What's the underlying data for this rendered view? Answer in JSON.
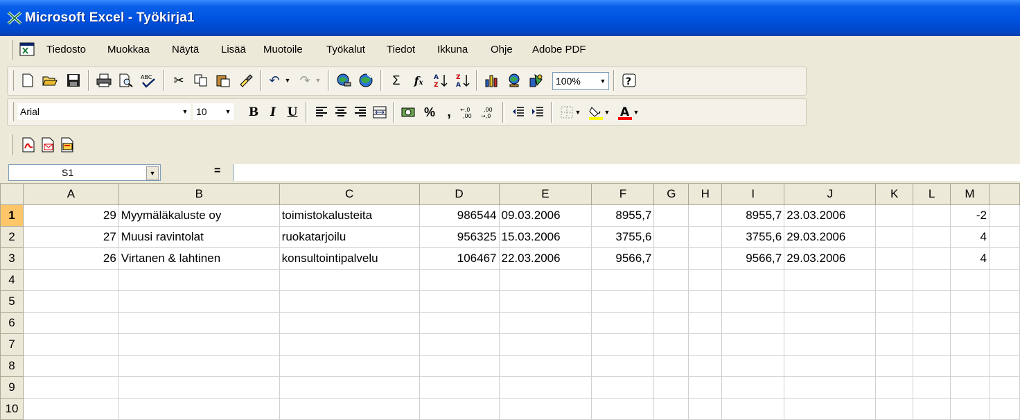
{
  "window": {
    "title": "Microsoft Excel - Työkirja1"
  },
  "menu": {
    "items": [
      "Tiedosto",
      "Muokkaa",
      "Näytä",
      "Lisää",
      "Muotoile",
      "Työkalut",
      "Tiedot",
      "Ikkuna",
      "Ohje",
      "Adobe PDF"
    ]
  },
  "toolbar": {
    "zoom": "100%"
  },
  "format_toolbar": {
    "font": "Arial",
    "size": "10"
  },
  "formula_bar": {
    "cell_ref": "S1",
    "equals": "="
  },
  "sheet": {
    "columns": [
      "A",
      "B",
      "C",
      "D",
      "E",
      "F",
      "G",
      "H",
      "I",
      "J",
      "K",
      "L",
      "M"
    ],
    "rows": [
      [
        "29",
        "Myymäläkaluste oy",
        "toimistokalusteita",
        "986544",
        "09.03.2006",
        "8955,7",
        "",
        "",
        "8955,7",
        "23.03.2006",
        "",
        "",
        "-2"
      ],
      [
        "27",
        "Muusi ravintolat",
        "ruokatarjoilu",
        "956325",
        "15.03.2006",
        "3755,6",
        "",
        "",
        "3755,6",
        "29.03.2006",
        "",
        "",
        "4"
      ],
      [
        "26",
        "Virtanen & lahtinen",
        "konsultointipalvelu",
        "106467",
        "22.03.2006",
        "9566,7",
        "",
        "",
        "9566,7",
        "29.03.2006",
        "",
        "",
        "4"
      ],
      [
        "",
        "",
        "",
        "",
        "",
        "",
        "",
        "",
        "",
        "",
        "",
        "",
        ""
      ],
      [
        "",
        "",
        "",
        "",
        "",
        "",
        "",
        "",
        "",
        "",
        "",
        "",
        ""
      ],
      [
        "",
        "",
        "",
        "",
        "",
        "",
        "",
        "",
        "",
        "",
        "",
        "",
        ""
      ],
      [
        "",
        "",
        "",
        "",
        "",
        "",
        "",
        "",
        "",
        "",
        "",
        "",
        ""
      ],
      [
        "",
        "",
        "",
        "",
        "",
        "",
        "",
        "",
        "",
        "",
        "",
        "",
        ""
      ],
      [
        "",
        "",
        "",
        "",
        "",
        "",
        "",
        "",
        "",
        "",
        "",
        "",
        ""
      ],
      [
        "",
        "",
        "",
        "",
        "",
        "",
        "",
        "",
        "",
        "",
        "",
        "",
        ""
      ]
    ],
    "row_numbers": [
      "1",
      "2",
      "3",
      "4",
      "5",
      "6",
      "7",
      "8",
      "9",
      "10"
    ]
  }
}
